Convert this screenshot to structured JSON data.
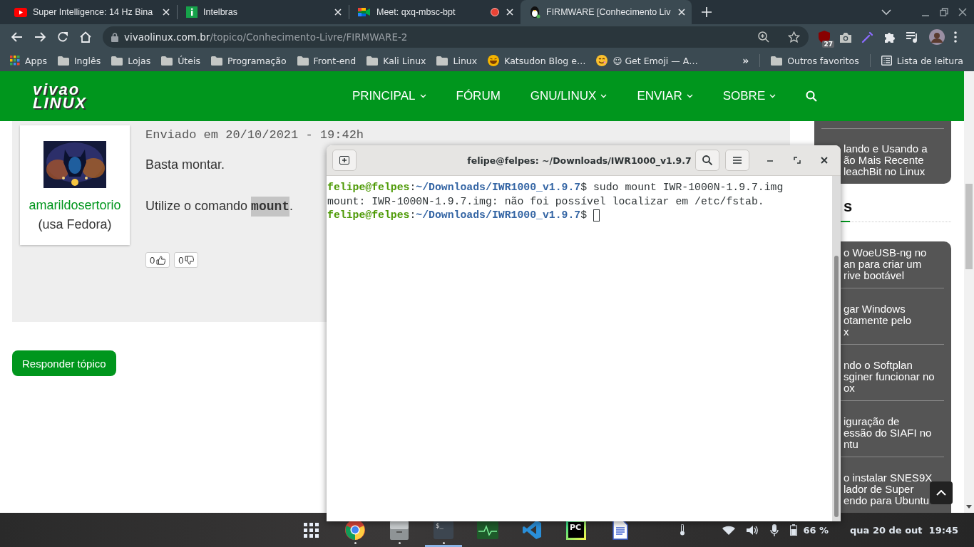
{
  "browser": {
    "tabs": [
      {
        "kind": "youtube",
        "title": "Super Intelligence: 14 Hz Bina",
        "selected": false,
        "recording": false
      },
      {
        "kind": "intelbras",
        "title": "Intelbras",
        "selected": false,
        "recording": false
      },
      {
        "kind": "meet",
        "title": "Meet: qxq-mbsc-bpt",
        "selected": false,
        "recording": true
      },
      {
        "kind": "tux",
        "title": "FIRMWARE [Conhecimento Liv",
        "selected": true,
        "recording": false
      }
    ],
    "address": {
      "domain": "vivaolinux.com.br",
      "path": "/topico/Conhecimento-Livre/FIRMWARE-2"
    },
    "extension_badge": "27",
    "bookmarks": [
      {
        "kind": "apps",
        "label": "Apps"
      },
      {
        "kind": "folder",
        "label": "Inglês"
      },
      {
        "kind": "folder",
        "label": "Lojas"
      },
      {
        "kind": "folder",
        "label": "Úteis"
      },
      {
        "kind": "folder",
        "label": "Programação"
      },
      {
        "kind": "folder",
        "label": "Front-end"
      },
      {
        "kind": "folder",
        "label": "Kali Linux"
      },
      {
        "kind": "folder",
        "label": "Linux"
      },
      {
        "kind": "laugh",
        "label": "Katsudon Blog e…"
      },
      {
        "kind": "smile",
        "label": "☺ Get Emoji — A…"
      }
    ],
    "more": "»",
    "other_bookmarks": [
      {
        "kind": "folder",
        "label": "Outros favoritos"
      },
      {
        "kind": "reading",
        "label": "Lista de leitura"
      }
    ]
  },
  "site": {
    "logo": [
      "vivao",
      "LINUX"
    ],
    "nav": [
      {
        "label": "PRINCIPAL",
        "dropdown": true
      },
      {
        "label": "FÓRUM",
        "dropdown": false
      },
      {
        "label": "GNU/LINUX",
        "dropdown": true
      },
      {
        "label": "ENVIAR",
        "dropdown": true
      },
      {
        "label": "SOBRE",
        "dropdown": true
      }
    ],
    "post": {
      "author": "amarildosertorio",
      "distro": "(usa Fedora)",
      "date": "Enviado em 20/10/2021 - 19:42h",
      "paragraphs": [
        [
          {
            "text": "Basta montar."
          }
        ],
        [
          {
            "text": "Utilize o comando "
          },
          {
            "text": "mount",
            "code": true
          },
          {
            "text": "."
          }
        ]
      ],
      "votes": [
        {
          "kind": "up",
          "count": "0"
        },
        {
          "kind": "down",
          "count": "0"
        }
      ]
    },
    "reply_button": "Responder tópico",
    "sidebar": {
      "top_card": [
        [
          "lando e Usando a",
          "ão Mais Recente",
          "leachBit no Linux"
        ]
      ],
      "heading": "s",
      "card": [
        [
          "o WoeUSB-ng no",
          "an para criar um",
          "rive bootável"
        ],
        [
          "gar Windows",
          "otamente pelo",
          "x"
        ],
        [
          "ndo o Softplan",
          "sginer funcionar no",
          "ox"
        ],
        [
          "iguração de",
          "essão do SIAFI no",
          "ntu"
        ],
        [
          "o instalar SNES9X",
          "lador de Super",
          "endo para Ubuntu"
        ]
      ]
    }
  },
  "terminal": {
    "title": "felipe@felpes: ~/Downloads/IWR1000_v1.9.7",
    "lines": [
      {
        "kind": "prompt",
        "user": "felipe@felpes",
        "sep": ":",
        "path": "~/Downloads/IWR1000_v1.9.7",
        "symbol": "$",
        "command": "sudo mount IWR-1000N-1.9.7.img"
      },
      {
        "kind": "output",
        "text": "mount: IWR-1000N-1.9.7.img: não foi possível localizar em /etc/fstab."
      },
      {
        "kind": "prompt",
        "user": "felipe@felpes",
        "sep": ":",
        "path": "~/Downloads/IWR1000_v1.9.7",
        "symbol": "$",
        "cursor": true
      }
    ]
  },
  "taskbar": {
    "apps": [
      {
        "kind": "grid",
        "selected": false,
        "running": false
      },
      {
        "kind": "chrome",
        "selected": false,
        "running": true
      },
      {
        "kind": "files",
        "selected": false,
        "running": true
      },
      {
        "kind": "terminal",
        "label": "$_",
        "selected": true,
        "running": true
      },
      {
        "kind": "monitor",
        "selected": false,
        "running": false
      },
      {
        "kind": "vscode",
        "selected": false,
        "running": false
      },
      {
        "kind": "pycharm",
        "label": "PC",
        "selected": false,
        "running": false
      },
      {
        "kind": "writer",
        "selected": false,
        "running": false
      }
    ],
    "battery": "66 %",
    "clock": "qua 20 de out  19:45"
  }
}
